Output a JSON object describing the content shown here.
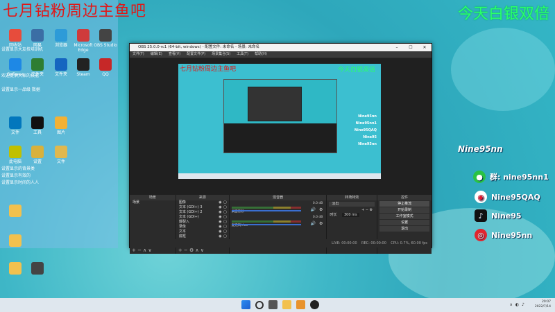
{
  "overlay": {
    "red_text": "七月钻粉周边主鱼吧",
    "green_text": "今天白银双倍"
  },
  "desktop": {
    "side_text_1": "设置显示大友技培训机",
    "side_text_2": "欢迎提供大家的技能",
    "side_text_3": "设置显示一品级 数据",
    "side_text_4": "设置显示的背景类",
    "side_text_5": "设置显示有效的 ",
    "side_text_6": "设置显示时间的人人",
    "icons": [
      "回收站",
      "网易",
      "浏览器",
      "Microsoft Edge",
      "OBS Studio",
      "GeForce",
      "文件夹",
      "文件夹",
      "Steam",
      "QQ",
      "文件",
      "工具",
      "图片",
      "此电脑",
      "设置",
      "文件"
    ]
  },
  "obs": {
    "title": "OBS 25.0.0-rc1 (64-bit, windows) - 配置文件: 未命名 - 场景: 未命名",
    "menu": [
      "文件(F)",
      "编辑(E)",
      "查看(V)",
      "配置文件(P)",
      "场景集合(S)",
      "工具(T)",
      "帮助(H)"
    ],
    "preview_red": "七月钻粉周边主鱼吧",
    "preview_green": "今天白银双倍",
    "preview_social": [
      "Nine95nn",
      "Nine95nn1",
      "Nine95QAQ",
      "Nine95",
      "Nine95nn"
    ],
    "docks": {
      "scenes_title": "场景",
      "scenes_item": "场景",
      "sources_title": "来源",
      "sources": [
        "图像",
        "文本 (GDI+) 3",
        "文本 (GDI+) 2",
        "文本 (GDI+)",
        "爆裂入",
        "录像",
        "文本",
        "底框"
      ],
      "mixer_title": "混音器",
      "mixer": [
        {
          "name": "桌面音频",
          "db": "0.0 dB"
        },
        {
          "name": "麦克风/Aux",
          "db": "0.0 dB"
        }
      ],
      "transitions_title": "转场特效",
      "transition_type": "淡出",
      "duration_label": "时长",
      "duration_value": "300 ms",
      "controls_title": "控件",
      "controls": [
        "停止推流",
        "开始录制",
        "工作室模式",
        "设置",
        "退出"
      ]
    },
    "status": {
      "live": "LIVE: 00:00:00",
      "rec": "REC: 00:00:00",
      "cpu": "CPU: 0.7%, 60.00 fps"
    }
  },
  "social_overlay": {
    "title": "Nine95nn",
    "items": [
      {
        "label": "群: nine95nn1",
        "icon": "wechat-icon",
        "color": "#29c244"
      },
      {
        "label": "Nine95QAQ",
        "icon": "weibo-icon",
        "color": "#e6162d"
      },
      {
        "label": "Nine95",
        "icon": "tiktok-icon",
        "color": "#111111"
      },
      {
        "label": "Nine95nn",
        "icon": "netease-music-icon",
        "color": "#e0262f"
      }
    ]
  },
  "taskbar": {
    "time": "20:07",
    "date": "2022/7/14"
  }
}
